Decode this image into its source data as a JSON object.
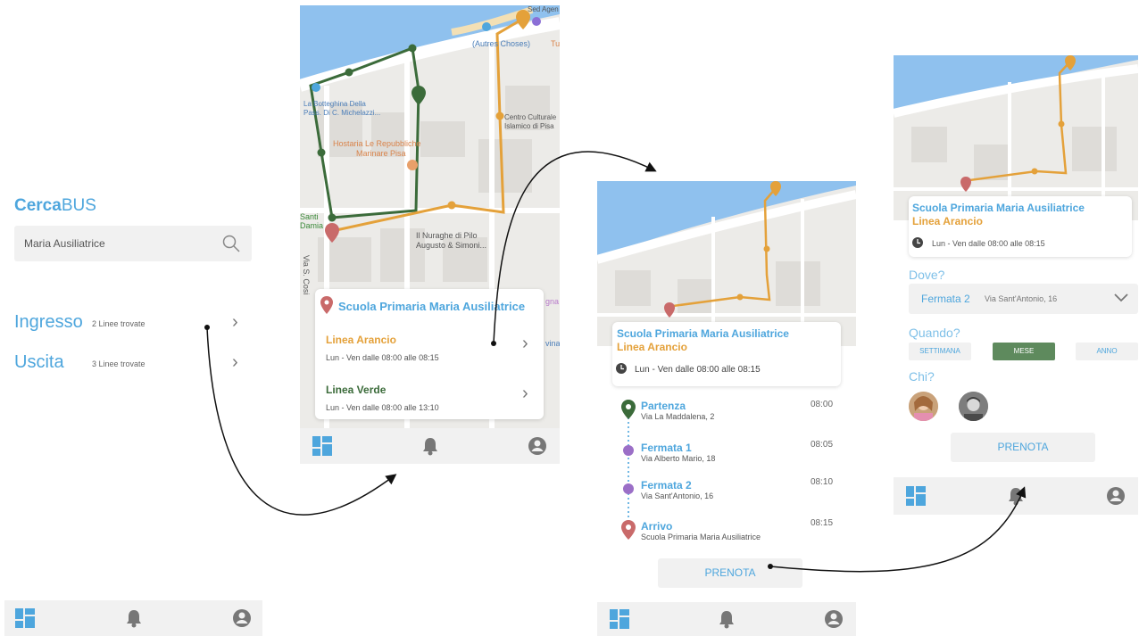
{
  "screen1": {
    "logo_a": "Cerca",
    "logo_b": "BUS",
    "search_value": "Maria Ausiliatrice",
    "rows": [
      {
        "label": "Ingresso",
        "count": "2 Linee trovate"
      },
      {
        "label": "Uscita",
        "count": "3 Linee trovate"
      }
    ]
  },
  "screen2": {
    "map_labels": [
      "(Autres Choses)",
      "La Botteghina Della",
      "Pass. Di C. Michelazzi...",
      "Centro Culturale",
      "Islamico di Pisa",
      "Hostaria Le Repubbliche",
      "Marinare Pisa",
      "Il Nuraghe di Pilo",
      "Augusto & Simoni...",
      "Via S. Cosi",
      "Santi",
      "Damia",
      "Tu",
      "Sed Agen",
      "gna",
      "vina"
    ],
    "school": "Scuola Primaria Maria Ausiliatrice",
    "lines": [
      {
        "name": "Linea Arancio",
        "time": "Lun - Ven dalle 08:00 alle 08:15"
      },
      {
        "name": "Linea Verde",
        "time": "Lun - Ven dalle 08:00 alle 13:10"
      }
    ]
  },
  "screen3": {
    "school": "Scuola Primaria Maria Ausiliatrice",
    "line": "Linea Arancio",
    "time": "Lun - Ven dalle 08:00 alle 08:15",
    "stops": [
      {
        "name": "Partenza",
        "addr": "Via La Maddalena, 2",
        "time": "08:00"
      },
      {
        "name": "Fermata 1",
        "addr": "Via Alberto Mario, 18",
        "time": "08:05"
      },
      {
        "name": "Fermata 2",
        "addr": "Via Sant'Antonio, 16",
        "time": "08:10"
      },
      {
        "name": "Arrivo",
        "addr": "Scuola Primaria Maria Ausiliatrice",
        "time": "08:15"
      }
    ],
    "book": "PRENOTA"
  },
  "screen4": {
    "school": "Scuola Primaria Maria Ausiliatrice",
    "line": "Linea Arancio",
    "time": "Lun - Ven dalle 08:00 alle 08:15",
    "where_label": "Dove?",
    "stop_name": "Fermata 2",
    "stop_addr": "Via Sant'Antonio, 16",
    "when_label": "Quando?",
    "periods": [
      "SETTIMANA",
      "MESE",
      "ANNO"
    ],
    "who_label": "Chi?",
    "book": "PRENOTA"
  },
  "colors": {
    "accent": "#4ea6dd",
    "orange": "#e4a13a",
    "green": "#3b6b3a",
    "red": "#c96a6a",
    "purple": "#9b6fc7"
  }
}
